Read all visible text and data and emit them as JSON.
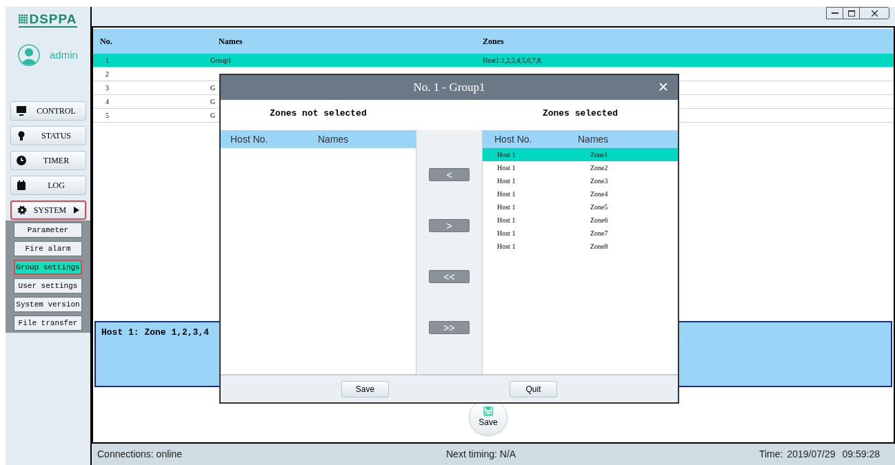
{
  "logo": "DSPPA",
  "user": {
    "name": "admin"
  },
  "nav": [
    {
      "label": "CONTROL",
      "selected": false
    },
    {
      "label": "STATUS",
      "selected": false
    },
    {
      "label": "TIMER",
      "selected": false
    },
    {
      "label": "LOG",
      "selected": false
    },
    {
      "label": "SYSTEM",
      "selected": true,
      "expanded": true,
      "children": [
        {
          "label": "Parameter",
          "selected": false
        },
        {
          "label": "Fire alarm",
          "selected": false
        },
        {
          "label": "Group settings",
          "selected": true
        },
        {
          "label": "User settings",
          "selected": false
        },
        {
          "label": "System version",
          "selected": false
        },
        {
          "label": "File transfer",
          "selected": false
        }
      ]
    }
  ],
  "table": {
    "columns": [
      "No.",
      "Names",
      "Zones"
    ],
    "rows": [
      {
        "no": "1",
        "name": "Group1",
        "zones": "Host1:1,2,3,4,5,6,7,8,",
        "selected": true
      },
      {
        "no": "2",
        "selected": false
      },
      {
        "no": "3",
        "name": "G",
        "selected": false
      },
      {
        "no": "4",
        "name": "G",
        "selected": false
      },
      {
        "no": "5",
        "name": "G",
        "selected": false
      }
    ]
  },
  "detail": "Host 1: Zone 1,2,3,4",
  "save_button": "Save",
  "status_bar": {
    "connections": "Connections: online",
    "next_timing": "Next timing: N/A",
    "time_label": "Time:",
    "date": "2019/07/29",
    "time": "09:59:28"
  },
  "dialog": {
    "title": "No. 1 - Group1",
    "left_heading": "Zones not selected",
    "right_heading": "Zones selected",
    "left_list": {
      "columns": [
        "Host No.",
        "Names"
      ]
    },
    "right_list": {
      "columns": [
        "Host No.",
        "Names"
      ],
      "rows": [
        {
          "host": "Host 1",
          "name": "Zone1",
          "selected": true
        },
        {
          "host": "Host 1",
          "name": "Zone2",
          "selected": false
        },
        {
          "host": "Host 1",
          "name": "Zone3",
          "selected": false
        },
        {
          "host": "Host 1",
          "name": "Zone4",
          "selected": false
        },
        {
          "host": "Host 1",
          "name": "Zone5",
          "selected": false
        },
        {
          "host": "Host 1",
          "name": "Zone6",
          "selected": false
        },
        {
          "host": "Host 1",
          "name": "Zone7",
          "selected": false
        },
        {
          "host": "Host 1",
          "name": "Zone8",
          "selected": false
        }
      ]
    },
    "move_buttons": [
      "<",
      ">",
      "<<",
      ">>"
    ],
    "buttons": [
      "Save",
      "Quit"
    ]
  }
}
